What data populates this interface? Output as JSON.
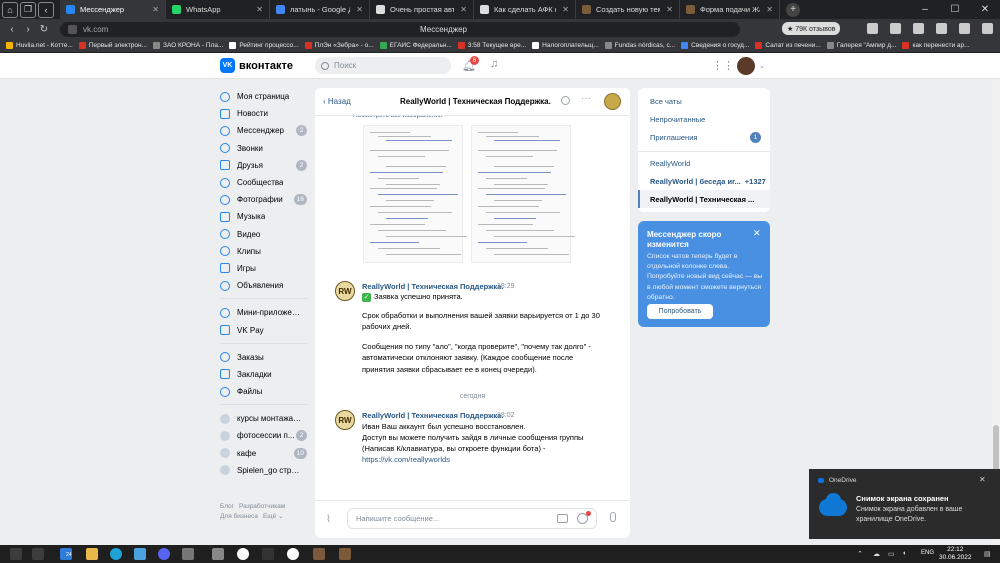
{
  "browser": {
    "tabs": [
      {
        "label": "Мессенджер",
        "active": true,
        "color": "#2787f5"
      },
      {
        "label": "WhatsApp",
        "active": false,
        "color": "#25d366"
      },
      {
        "label": "латынь - Google Докумен",
        "active": false,
        "color": "#4285f4"
      },
      {
        "label": "Очень простая автомати",
        "active": false,
        "color": "#dddddd"
      },
      {
        "label": "Как сделать АФК ферму э",
        "active": false,
        "color": "#dddddd"
      },
      {
        "label": "Создать новую тему - Re",
        "active": false,
        "color": "#7a5c3a"
      },
      {
        "label": "Форма подачи Жалобы н",
        "active": false,
        "color": "#7a5c3a"
      }
    ],
    "url": "vk.com",
    "page_title": "Мессенджер",
    "reviews_badge": "★ 79К отзывов",
    "bookmarks": [
      {
        "label": "Huvila.net - Котте...",
        "color": "#f4b400"
      },
      {
        "label": "Первый электрон...",
        "color": "#d93025"
      },
      {
        "label": "ЗАО КРОНА - Пла...",
        "color": "#888888"
      },
      {
        "label": "Рейтинг процессо...",
        "color": "#ffffff"
      },
      {
        "label": "ПлЭн «Зебра» - о...",
        "color": "#d93025"
      },
      {
        "label": "ЕГАИС Федеральн...",
        "color": "#34a853"
      },
      {
        "label": "3:58 Текущее вре...",
        "color": "#d93025"
      },
      {
        "label": "Налогоплательщ...",
        "color": "#ffffff"
      },
      {
        "label": "Fundas nórdicas, c...",
        "color": "#888888"
      },
      {
        "label": "Сведения о госуд...",
        "color": "#4285f4"
      },
      {
        "label": "Салат из печени...",
        "color": "#d93025"
      },
      {
        "label": "Галерея \"Ампир д...",
        "color": "#888888"
      },
      {
        "label": "как перенести ар...",
        "color": "#d93025"
      }
    ]
  },
  "vk": {
    "logo_text": "вконтакте",
    "logo_mark": "VK",
    "search_placeholder": "Поиск",
    "notifications_count": "6"
  },
  "nav": {
    "items": [
      {
        "label": "Моя страница",
        "badge": ""
      },
      {
        "label": "Новости",
        "badge": ""
      },
      {
        "label": "Мессенджер",
        "badge": "2"
      },
      {
        "label": "Звонки",
        "badge": ""
      },
      {
        "label": "Друзья",
        "badge": "2"
      },
      {
        "label": "Сообщества",
        "badge": ""
      },
      {
        "label": "Фотографии",
        "badge": "16"
      },
      {
        "label": "Музыка",
        "badge": ""
      },
      {
        "label": "Видео",
        "badge": ""
      },
      {
        "label": "Клипы",
        "badge": ""
      },
      {
        "label": "Игры",
        "badge": ""
      },
      {
        "label": "Объявления",
        "badge": ""
      }
    ],
    "items2": [
      {
        "label": "Мини-приложения",
        "badge": ""
      },
      {
        "label": "VK Pay",
        "badge": ""
      }
    ],
    "items3": [
      {
        "label": "Заказы",
        "badge": ""
      },
      {
        "label": "Закладки",
        "badge": ""
      },
      {
        "label": "Файлы",
        "badge": ""
      }
    ],
    "groups": [
      {
        "label": "курсы монтажа о ...",
        "badge": ""
      },
      {
        "label": "фотосессии п...",
        "badge": "2"
      },
      {
        "label": "кафе",
        "badge": "10"
      },
      {
        "label": "Spielen_go стрим...",
        "badge": ""
      }
    ],
    "footer": {
      "blog": "Блог",
      "devs": "Разработчикам",
      "business": "Для бизнеса",
      "more": "Ещё ⌄"
    }
  },
  "chat": {
    "back_label": "Назад",
    "title": "ReallyWorld | Техническая Поддержка.",
    "view_all": "Посмотреть все изображения",
    "day_divider": "сегодня",
    "composer_placeholder": "Напишите сообщение...",
    "messages": [
      {
        "author": "ReallyWorld | Техническая Поддержка.",
        "time": "18:29",
        "avatar": "RW",
        "line1": "Заявка успешно принята.",
        "para2": "Срок обработки и выполнения вашей заявки варьируется от 1 до 30 рабочих дней.",
        "para3": "Сообщения по типу \"ало\", \"когда проверите\", \"почему так долго\" - автоматически отклоняют заявку. (Каждое сообщение после принятия заявки сбрасывает ее в конец очереди)."
      },
      {
        "author": "ReallyWorld | Техническая Поддержка.",
        "time": "18:02",
        "avatar": "RW",
        "line1": "Иван Ваш аккаунт был успешно восстановлен.",
        "para2": "Доступ вы можете получить зайдя в личные сообщения группы (Написав К/клавиатура, вы откроете функции бота) -",
        "link": "https://vk.com/reallyworlds"
      }
    ]
  },
  "right_panel": {
    "all_chats": "Все чаты",
    "unread": "Непрочитанные",
    "invites": "Приглашения",
    "invites_badge": "1",
    "convos": [
      {
        "label": "ReallyWorld",
        "count": ""
      },
      {
        "label": "ReallyWorld | беседа иг...",
        "count": "+1327"
      },
      {
        "label": "ReallyWorld | Техническая ...",
        "count": ""
      }
    ]
  },
  "promo": {
    "title": "Мессенджер скоро изменится",
    "text": "Список чатов теперь будет в отдельной колонке слева. Попробуйте новый вид сейчас — вы в любой момент сможете вернуться обратно.",
    "button": "Попробовать"
  },
  "toast": {
    "app": "OneDrive",
    "title": "Снимок экрана сохранен",
    "body": "Снимок экрана добавлен в ваше хранилище OneDrive."
  },
  "taskbar": {
    "lang": "ENG",
    "time": "22:12",
    "date": "30.06.2022",
    "mail_badge": "24"
  }
}
